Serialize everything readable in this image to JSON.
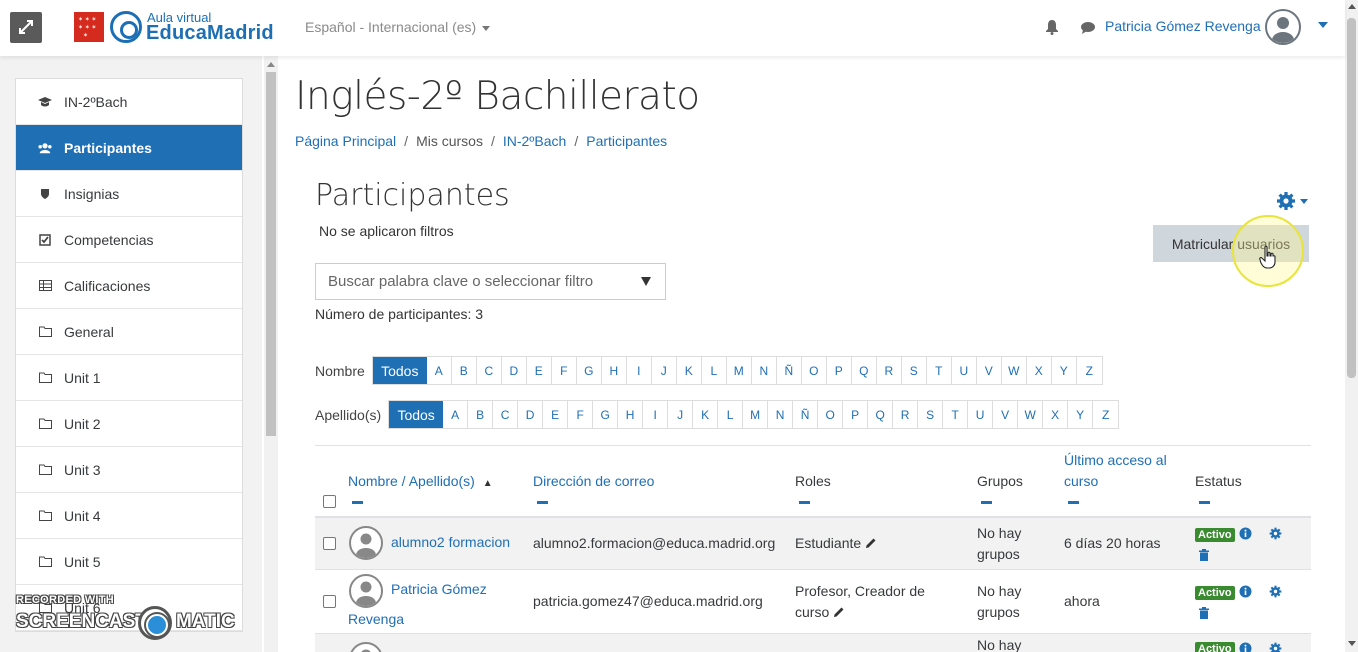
{
  "header": {
    "logo_small": "Aula virtual",
    "logo_big": "EducaMadrid",
    "language": "Español - Internacional (es)",
    "user_name": "Patricia Gómez Revenga"
  },
  "sidebar": {
    "items": [
      {
        "label": "IN-2ºBach",
        "icon": "graduation-cap-icon"
      },
      {
        "label": "Participantes",
        "icon": "users-icon"
      },
      {
        "label": "Insignias",
        "icon": "shield-icon"
      },
      {
        "label": "Competencias",
        "icon": "check-square-icon"
      },
      {
        "label": "Calificaciones",
        "icon": "table-icon"
      },
      {
        "label": "General",
        "icon": "folder-icon"
      },
      {
        "label": "Unit 1",
        "icon": "folder-icon"
      },
      {
        "label": "Unit 2",
        "icon": "folder-icon"
      },
      {
        "label": "Unit 3",
        "icon": "folder-icon"
      },
      {
        "label": "Unit 4",
        "icon": "folder-icon"
      },
      {
        "label": "Unit 5",
        "icon": "folder-icon"
      },
      {
        "label": "Unit 6",
        "icon": "folder-icon"
      }
    ],
    "active_index": 1
  },
  "watermark": {
    "top": "RECORDED WITH",
    "left": "SCREENCAST",
    "right": "MATIC"
  },
  "main": {
    "course_title": "Inglés-2º Bachillerato",
    "breadcrumb": [
      "Página Principal",
      "Mis cursos",
      "IN-2ºBach",
      "Participantes"
    ],
    "section_title": "Participantes",
    "no_filters": "No se aplicaron filtros",
    "enrol_button": "Matricular usuarios",
    "filter_placeholder": "Buscar palabra clave o seleccionar filtro",
    "participant_count": "Número de participantes: 3",
    "firstname_label": "Nombre",
    "lastname_label": "Apellido(s)",
    "all_label": "Todos",
    "letters": [
      "A",
      "B",
      "C",
      "D",
      "E",
      "F",
      "G",
      "H",
      "I",
      "J",
      "K",
      "L",
      "M",
      "N",
      "Ñ",
      "O",
      "P",
      "Q",
      "R",
      "S",
      "T",
      "U",
      "V",
      "W",
      "X",
      "Y",
      "Z"
    ]
  },
  "table": {
    "headers": {
      "name": "Nombre / Apellido(s)",
      "email": "Dirección de correo",
      "roles": "Roles",
      "groups": "Grupos",
      "last_access_1": "Último acceso al",
      "last_access_2": "curso",
      "status": "Estatus"
    },
    "rows": [
      {
        "name_1": "alumno2 formacion",
        "name_2": "",
        "email": "alumno2.formacion@educa.madrid.org",
        "roles_1": "Estudiante",
        "roles_2": "",
        "groups_1": "No hay",
        "groups_2": "grupos",
        "last_access": "6 días 20 horas",
        "status": "Activo"
      },
      {
        "name_1": "Patricia Gómez",
        "name_2": "Revenga",
        "email": "patricia.gomez47@educa.madrid.org",
        "roles_1": "Profesor, Creador de",
        "roles_2": "curso",
        "groups_1": "No hay",
        "groups_2": "grupos",
        "last_access": "ahora",
        "status": "Activo"
      },
      {
        "groups_1": "No hay",
        "status": "Activo"
      }
    ]
  },
  "colors": {
    "primary": "#1f6fb5",
    "active_badge": "#3a8a30",
    "button_bg": "#cfd6dc"
  }
}
